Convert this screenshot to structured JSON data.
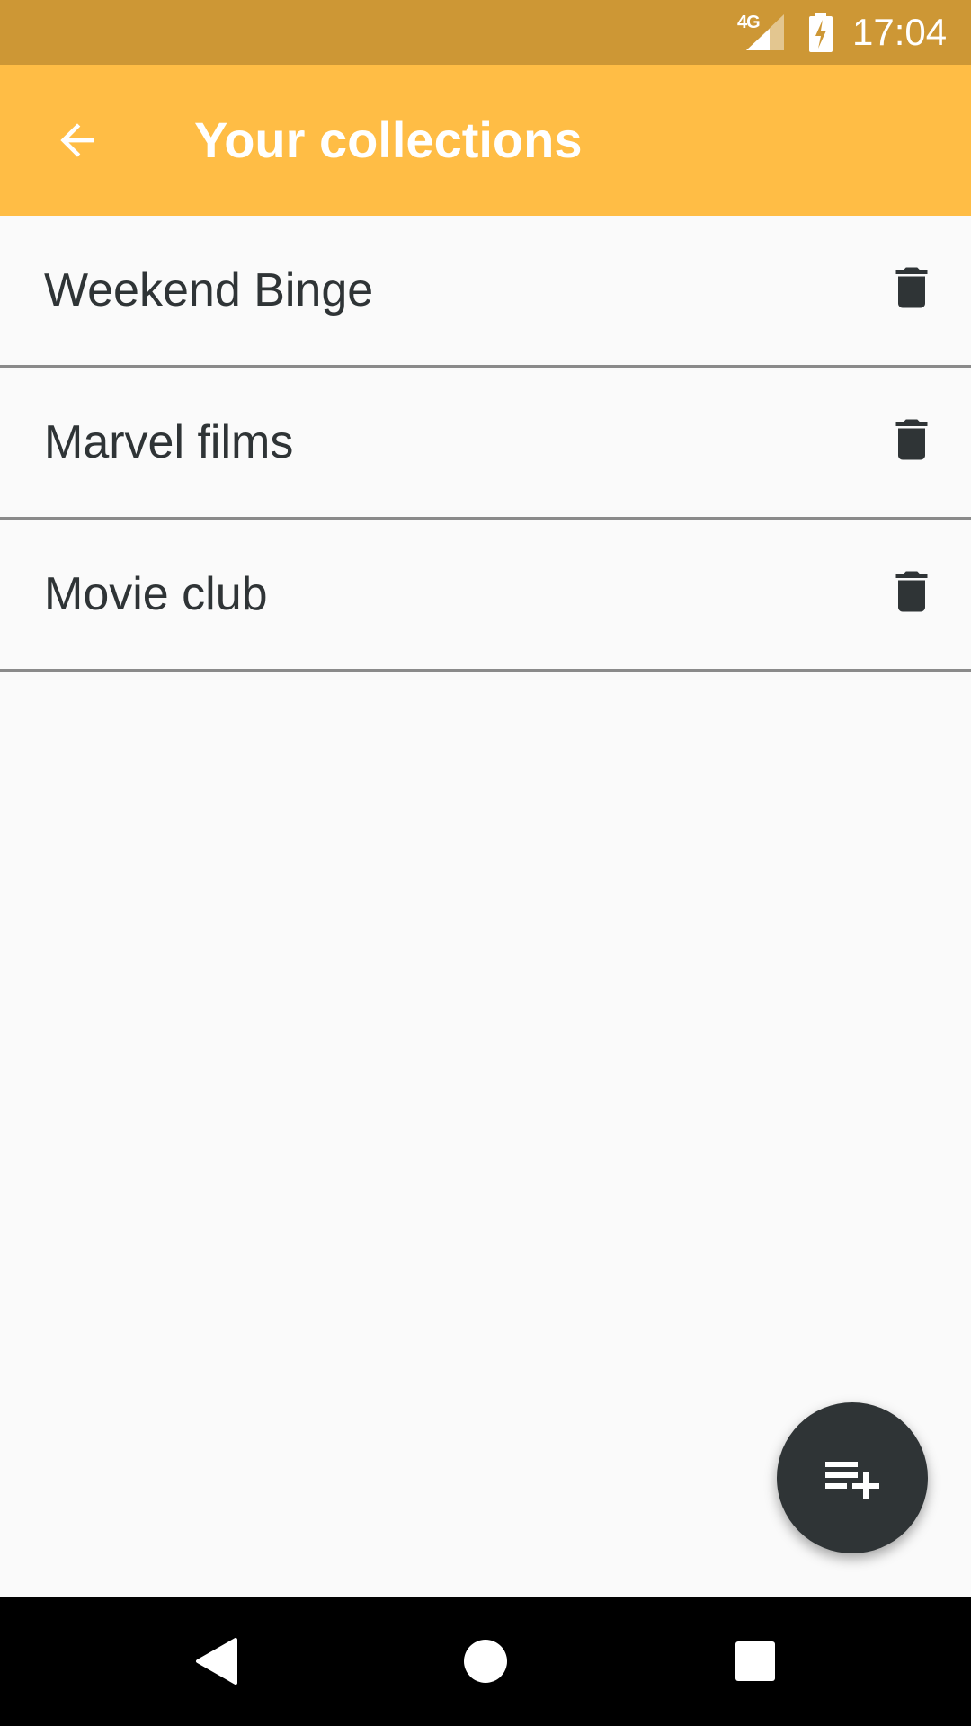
{
  "status_bar": {
    "network": "4G",
    "time": "17:04",
    "icons": [
      "signal-icon",
      "battery-charging-icon"
    ]
  },
  "app_bar": {
    "title": "Your collections",
    "back_icon": "arrow-back-icon"
  },
  "collections": [
    {
      "name": "Weekend Binge",
      "action_icon": "trash-icon"
    },
    {
      "name": "Marvel films",
      "action_icon": "trash-icon"
    },
    {
      "name": "Movie club",
      "action_icon": "trash-icon"
    }
  ],
  "fab": {
    "icon": "playlist-add-icon"
  },
  "nav_bar": {
    "buttons": [
      "back-triangle-icon",
      "home-circle-icon",
      "recents-square-icon"
    ]
  },
  "colors": {
    "status_bar": "#cd9735",
    "app_bar": "#ffbd45",
    "background": "#fafafa",
    "text": "#2f3436",
    "divider": "#8a8a8a",
    "fab": "#2f3436"
  }
}
